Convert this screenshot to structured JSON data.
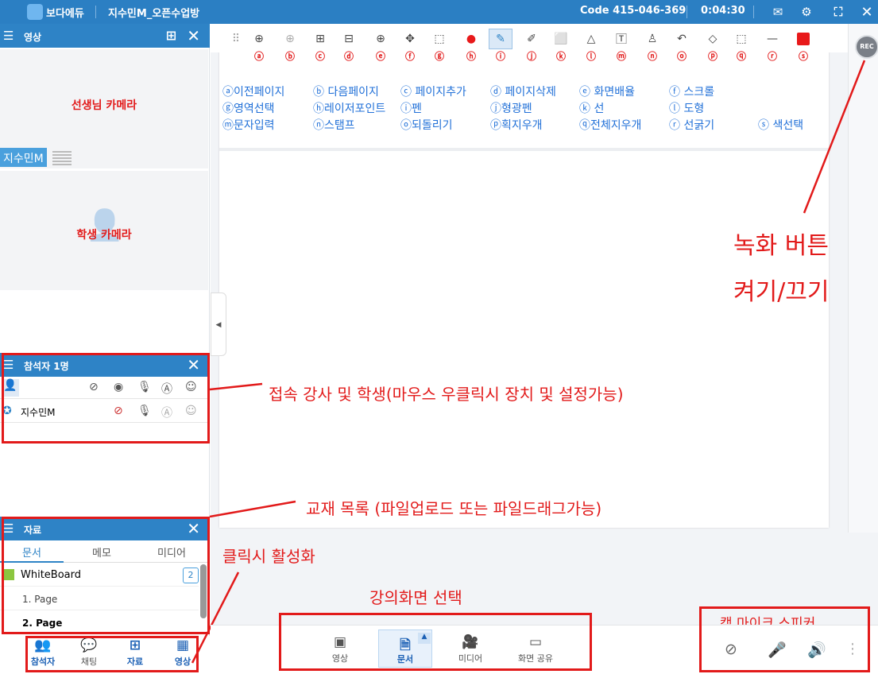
{
  "titlebar": {
    "brand": "보다에듀",
    "room": "지수민M_오픈수업방",
    "code": "Code 415-046-369",
    "timer": "0:04:30"
  },
  "video_panel": {
    "title": "영상",
    "teacher_cam": "선생님 카메라",
    "student_cam": "학생 카메라",
    "name_tag": "지수민M"
  },
  "participants": {
    "title": "참석자 1명",
    "user": "지수민M"
  },
  "materials": {
    "title": "자료",
    "tabs": [
      "문서",
      "메모",
      "미디어"
    ],
    "file": "WhiteBoard",
    "count": "2",
    "pages": [
      "1. Page",
      "2. Page"
    ]
  },
  "left_bottom": [
    "참석자",
    "채팅",
    "자료",
    "영상"
  ],
  "toolbar_letters": [
    "ⓐ",
    "ⓑ",
    "ⓒ",
    "ⓓ",
    "ⓔ",
    "ⓕ",
    "ⓖ",
    "ⓗ",
    "ⓘ",
    "ⓙ",
    "ⓚ",
    "ⓛ",
    "ⓜ",
    "ⓝ",
    "ⓞ",
    "ⓟ",
    "ⓠ",
    "ⓡ",
    "ⓢ"
  ],
  "legend": {
    "row1": [
      "ⓐ이전페이지",
      "ⓑ 다음페이지",
      "ⓒ 페이지추가",
      "ⓓ 페이지삭제",
      "ⓔ 화면배율",
      "ⓕ 스크롤"
    ],
    "row2": [
      "ⓖ영역선택",
      "ⓗ레이저포인트",
      "ⓘ펜",
      "ⓙ형광펜",
      "ⓚ 선",
      "ⓛ 도형"
    ],
    "row3": [
      "ⓜ문자입력",
      "ⓝ스탬프",
      "ⓞ되돌리기",
      "ⓟ획지우개",
      "ⓠ전체지우개",
      "ⓡ 선굵기",
      "ⓢ 색선택"
    ]
  },
  "rec": "REC",
  "annotations": {
    "record_line1": "녹화 버튼",
    "record_line2": "켜기/끄기",
    "participants": "접속 강사 및 학생(마우스 우클릭시 장치 및 설정가능)",
    "materials": "교재 목록 (파일업로드 또는 파일드래그가능)",
    "click_activate": "클릭시 활성화",
    "screen_select": "강의화면 선택",
    "devices": "캠 마이크 스피커"
  },
  "bottom_center": [
    "영상",
    "문서",
    "미디어",
    "화면 공유"
  ],
  "colors": {
    "primary": "#2e83c6",
    "annotation": "#e21a1a",
    "legend": "#2271d8",
    "toolbar_red": "#e8191a"
  }
}
